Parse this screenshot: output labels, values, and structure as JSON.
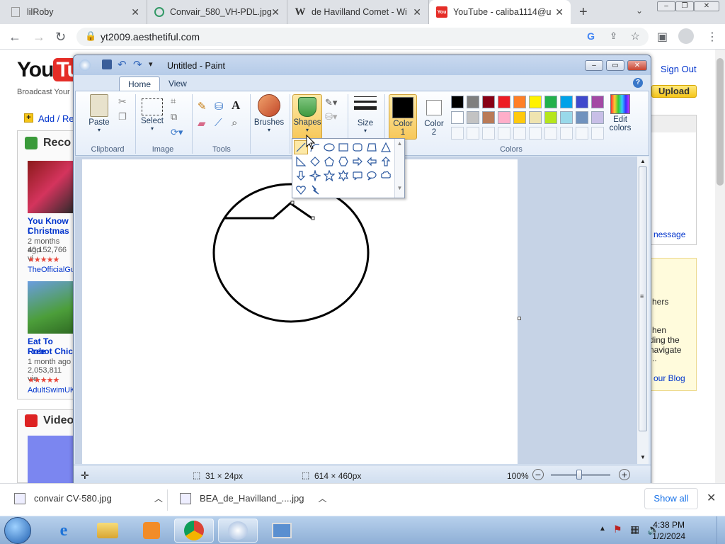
{
  "browser": {
    "tabs": [
      {
        "title": "lilRoby"
      },
      {
        "title": "Convair_580_VH-PDL.jpg"
      },
      {
        "title": "de Havilland Comet - Wi"
      },
      {
        "title": "YouTube - caliba1114@u"
      }
    ],
    "new_tab": "+",
    "url": "yt2009.aesthetiful.com"
  },
  "youtube": {
    "tagline": "Broadcast Your",
    "sign_out": "Sign Out",
    "upload": "Upload",
    "add_link": "Add / Re",
    "recommended_heading": "Reco",
    "videos_heading": "Video",
    "videos": [
      {
        "title1": "You Know I",
        "title2": "Christmas",
        "age": "2 months ago",
        "views": "40,152,766 vi",
        "user": "TheOfficialGu"
      },
      {
        "title1": "Eat To Free",
        "title2": "Robot Chic",
        "age": "1 month ago",
        "views": "2,053,811 vie",
        "user": "AdultSwimUK"
      }
    ],
    "right_message": "nessage",
    "right_text": [
      "hers",
      "hen",
      "ding the",
      "navigate",
      "..",
      "our Blog"
    ]
  },
  "paint": {
    "title": "Untitled - Paint",
    "tabs": {
      "home": "Home",
      "view": "View"
    },
    "groups": {
      "clipboard": "Clipboard",
      "image": "Image",
      "tools": "Tools",
      "colors": "Colors"
    },
    "buttons": {
      "paste": "Paste",
      "select": "Select",
      "brushes": "Brushes",
      "shapes": "Shapes",
      "size": "Size",
      "color1": "Color",
      "color1_num": "1",
      "color2": "Color",
      "color2_num": "2",
      "edit_colors_1": "Edit",
      "edit_colors_2": "colors"
    },
    "palette_row1": [
      "#000000",
      "#7f7f7f",
      "#880015",
      "#ed1c24",
      "#ff7f27",
      "#fff200",
      "#22b14c",
      "#00a2e8",
      "#3f48cc",
      "#a349a4"
    ],
    "palette_row2": [
      "#ffffff",
      "#c3c3c3",
      "#b97a57",
      "#ffaec9",
      "#ffc90e",
      "#efe4b0",
      "#b5e61d",
      "#99d9ea",
      "#7092be",
      "#c8bfe7"
    ],
    "color1_value": "#000000",
    "color2_value": "#ffffff",
    "status": {
      "selection": "31 × 24px",
      "image_size": "614 × 460px",
      "zoom": "100%"
    }
  },
  "downloads": {
    "items": [
      "convair CV-580.jpg",
      "BEA_de_Havilland_....jpg"
    ],
    "show_all": "Show all"
  },
  "taskbar": {
    "time": "4:38 PM",
    "date": "1/2/2024"
  }
}
